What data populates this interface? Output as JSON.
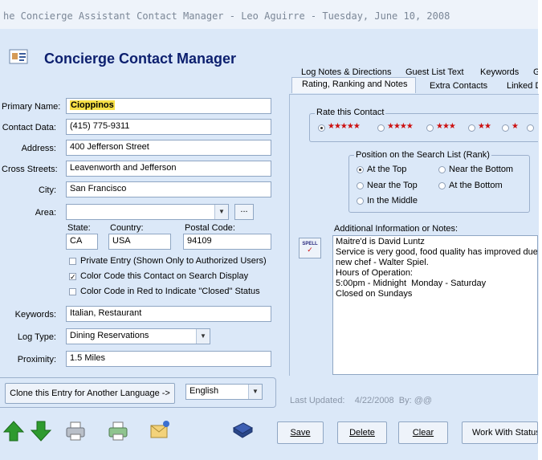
{
  "window": {
    "title": "he Concierge Assistant Contact Manager - Leo Aguirre - Tuesday, June 10, 2008"
  },
  "app": {
    "title": "Concierge Contact Manager"
  },
  "form": {
    "primary_name": {
      "label": "Primary Name:",
      "value": "Cioppinos"
    },
    "contact_data": {
      "label": "Contact Data:",
      "value": "(415) 775-9311"
    },
    "address": {
      "label": "Address:",
      "value": "400 Jefferson Street"
    },
    "cross_streets": {
      "label": "Cross Streets:",
      "value": "Leavenworth and Jefferson"
    },
    "city": {
      "label": "City:",
      "value": "San Francisco"
    },
    "area": {
      "label": "Area:",
      "value": "",
      "browse_label": "..."
    },
    "state": {
      "label": "State:",
      "value": "CA"
    },
    "country": {
      "label": "Country:",
      "value": "USA"
    },
    "postal_code": {
      "label": "Postal Code:",
      "value": "94109"
    },
    "checkboxes": [
      {
        "label": "Private Entry (Shown Only to Authorized Users)",
        "checked": false
      },
      {
        "label": "Color Code this Contact on Search Display",
        "checked": true
      },
      {
        "label": "Color Code in Red to Indicate \"Closed\" Status",
        "checked": false
      }
    ],
    "keywords": {
      "label": "Keywords:",
      "value": "Italian, Restaurant"
    },
    "log_type": {
      "label": "Log Type:",
      "value": "Dining Reservations"
    },
    "proximity": {
      "label": "Proximity:",
      "value": "1.5 Miles"
    },
    "clone_button": "Clone this Entry for Another Language  ->",
    "language": "English"
  },
  "tabs": {
    "row1": [
      "Log Notes & Directions",
      "Guest List Text",
      "Keywords",
      "G"
    ],
    "row2": [
      "Rating, Ranking and Notes",
      "Extra Contacts",
      "Linked D"
    ],
    "active": "Rating, Ranking and Notes"
  },
  "rating": {
    "group_label": "Rate this Contact",
    "options": [
      "★★★★★",
      "★★★★",
      "★★★",
      "★★",
      "★",
      ""
    ],
    "selected": 0
  },
  "rank": {
    "group_label": "Position on the Search List  (Rank)",
    "options": [
      "At the Top",
      "Near the Bottom",
      "Near the Top",
      "At the Bottom",
      "In the Middle"
    ],
    "selected": "At the Top"
  },
  "notes": {
    "label": "Additional Information or Notes:",
    "spell_label": "SPELL",
    "text": "Maitre'd is David Luntz\nService is very good, food quality has improved due to\nnew chef - Walter Spiel.\nHours of Operation:\n5:00pm - Midnight  Monday - Saturday\nClosed on Sundays"
  },
  "last_updated": {
    "label": "Last Updated:",
    "date": "4/22/2008",
    "by_label": "By:",
    "by": "@@"
  },
  "toolbar": {
    "icons": [
      "up-arrow-icon",
      "down-arrow-icon",
      "printer-icon",
      "print-preview-icon",
      "email-icon",
      "book-icon"
    ],
    "save": "Save",
    "delete": "Delete",
    "clear": "Clear",
    "work_with_status": "Work With Status"
  },
  "colors": {
    "client_bg": "#dbe8f8",
    "title_blue": "#0c1f6e",
    "highlight": "#f7e046",
    "star_red": "#cc1010",
    "arrow_green": "#2e9a2e"
  }
}
